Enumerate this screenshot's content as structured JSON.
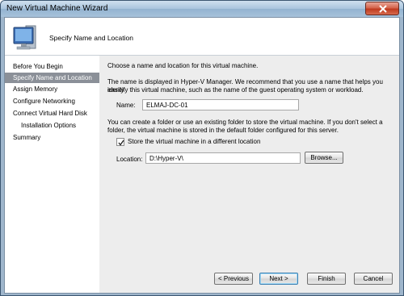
{
  "window": {
    "title": "New Virtual Machine Wizard"
  },
  "header": {
    "page_title": "Specify Name and Location",
    "icon": "computer-monitor-icon"
  },
  "sidebar": {
    "items": [
      {
        "label": "Before You Begin",
        "selected": false,
        "sub": false
      },
      {
        "label": "Specify Name and Location",
        "selected": true,
        "sub": false
      },
      {
        "label": "Assign Memory",
        "selected": false,
        "sub": false
      },
      {
        "label": "Configure Networking",
        "selected": false,
        "sub": false
      },
      {
        "label": "Connect Virtual Hard Disk",
        "selected": false,
        "sub": false
      },
      {
        "label": "Installation Options",
        "selected": false,
        "sub": true
      },
      {
        "label": "Summary",
        "selected": false,
        "sub": false
      }
    ]
  },
  "main": {
    "intro": "Choose a name and location for this virtual machine.",
    "name_desc_line1": "The name is displayed in Hyper-V Manager. We recommend that you use a name that helps you easily",
    "name_desc_line2": "identify this virtual machine, such as the name of the guest operating system or workload.",
    "name_label": "Name:",
    "name_value": "ELMAJ-DC-01",
    "folder_desc_line1": "You can create a folder or use an existing folder to store the virtual machine. If you don't select a",
    "folder_desc_line2": "folder, the virtual machine is stored in the default folder configured for this server.",
    "store_checkbox_label": "Store the virtual machine in a different location",
    "store_checked": true,
    "location_label": "Location:",
    "location_value": "D:\\Hyper-V\\",
    "browse_label": "Browse..."
  },
  "footer": {
    "previous_label": "< Previous",
    "next_label": "Next >",
    "finish_label": "Finish",
    "cancel_label": "Cancel"
  }
}
